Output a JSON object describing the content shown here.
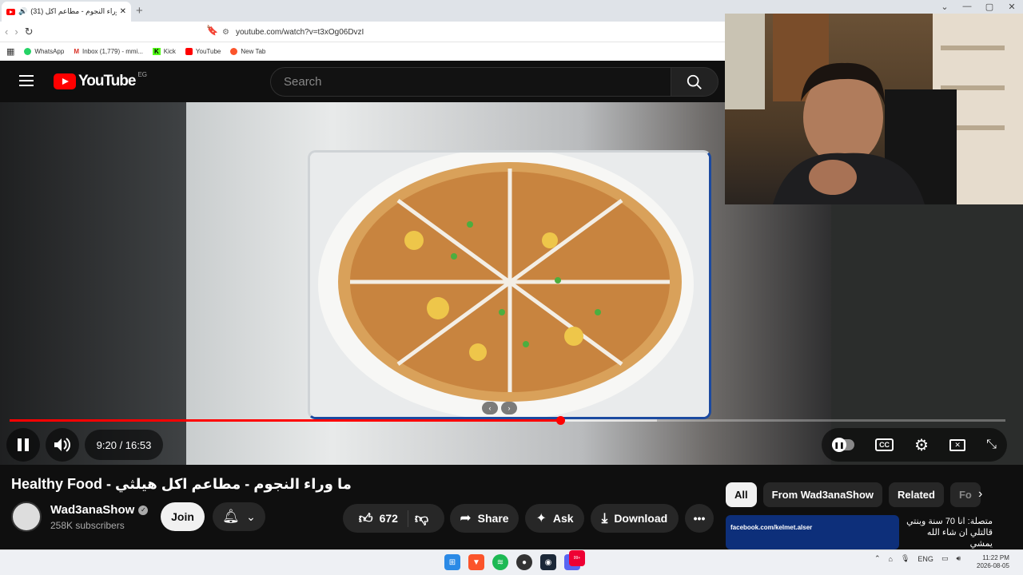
{
  "browser": {
    "tab_title": "(31) ما وراء النجوم - مطاعم اكل",
    "url": "youtube.com/watch?v=t3xOg06DvzI",
    "bookmarks": [
      "WhatsApp",
      "Inbox (1,779) - mmi...",
      "Kick",
      "YouTube",
      "New Tab"
    ]
  },
  "header": {
    "logo_text": "YouTube",
    "country_code": "EG",
    "search_placeholder": "Search"
  },
  "player": {
    "current_time": "9:20",
    "duration": "16:53",
    "time_label": "9:20 / 16:53",
    "progress_fraction": 0.553,
    "buffered_fraction": 0.65
  },
  "video": {
    "title": "ما وراء النجوم - مطاعم اكل هيلثي - Healthy Food",
    "channel": "Wad3anaShow",
    "subscribers": "258K subscribers",
    "join_label": "Join",
    "likes": "672",
    "share_label": "Share",
    "ask_label": "Ask",
    "download_label": "Download"
  },
  "chips": [
    "All",
    "From Wad3anaShow",
    "Related",
    "Fo"
  ],
  "recommendation": {
    "thumb_text": "facebook.com/kelmet.alser",
    "title": "متصلة: انا 70 سنة وبنتي قالتلي ان شاء الله يمشي"
  },
  "taskbar": {
    "lang": "ENG",
    "time": "11:22 PM",
    "date": "2026-08-05",
    "badge": "99+"
  },
  "colors": {
    "accent": "#ff0000",
    "background": "#0f0f0f",
    "chip_active": "#f1f1f1"
  }
}
